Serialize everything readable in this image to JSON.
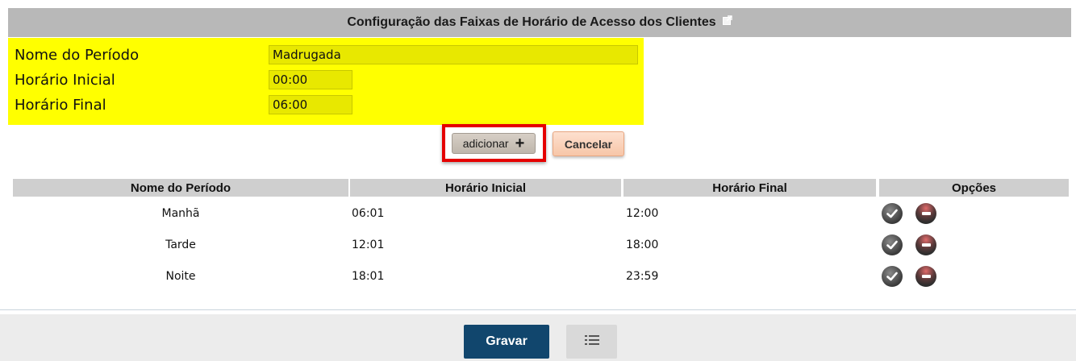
{
  "header": {
    "title": "Configuração das Faixas de Horário de Acesso dos Clientes",
    "icon": "external-link-icon"
  },
  "form": {
    "fields": [
      {
        "label": "Nome do Período",
        "value": "Madrugada"
      },
      {
        "label": "Horário Inicial",
        "value": "00:00"
      },
      {
        "label": "Horário Final",
        "value": "06:00"
      }
    ],
    "background_color": "#ffff00"
  },
  "actions": {
    "add_label": "adicionar",
    "add_icon": "plus-icon",
    "cancel_label": "Cancelar",
    "highlight_color": "#e50000"
  },
  "table": {
    "columns": [
      "Nome do Período",
      "Horário Inicial",
      "Horário Final",
      "Opções"
    ],
    "rows": [
      {
        "name": "Manhã",
        "start": "06:01",
        "end": "12:00"
      },
      {
        "name": "Tarde",
        "start": "12:01",
        "end": "18:00"
      },
      {
        "name": "Noite",
        "start": "18:01",
        "end": "23:59"
      }
    ],
    "row_icons": [
      "check-icon",
      "remove-icon"
    ]
  },
  "footer": {
    "save_label": "Gravar",
    "list_icon": "list-icon",
    "save_color": "#11466d"
  }
}
